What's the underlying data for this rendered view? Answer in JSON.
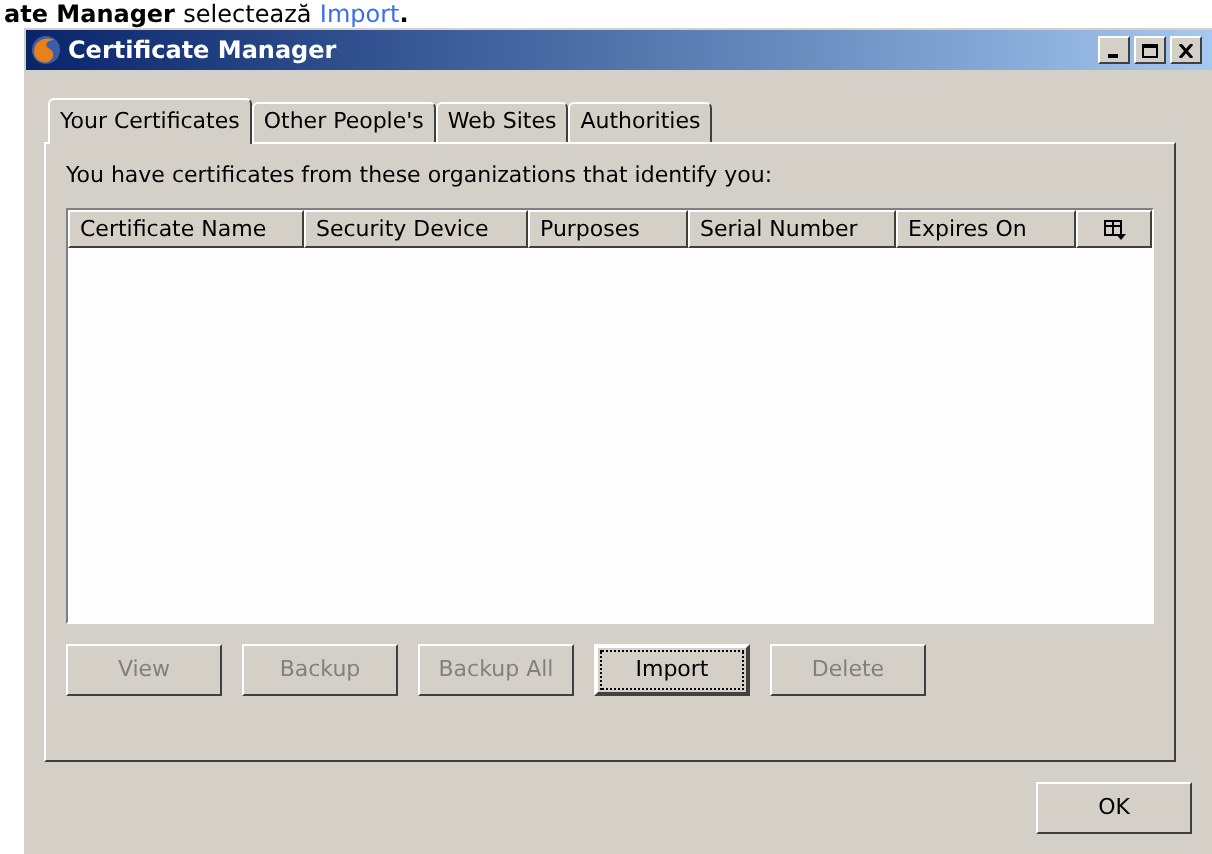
{
  "heading": {
    "text": "ate Manager",
    "rest": "selectează",
    "link": "Import",
    "end": "."
  },
  "window": {
    "title": "Certificate Manager"
  },
  "tabs": [
    {
      "label": "Your Certificates",
      "selected": true
    },
    {
      "label": "Other People's",
      "selected": false
    },
    {
      "label": "Web Sites",
      "selected": false
    },
    {
      "label": "Authorities",
      "selected": false
    }
  ],
  "description": "You have certificates from these organizations that identify you:",
  "table": {
    "columns": [
      "Certificate Name",
      "Security Device",
      "Purposes",
      "Serial Number",
      "Expires On"
    ]
  },
  "buttons": [
    {
      "label": "View",
      "disabled": true,
      "focused": false
    },
    {
      "label": "Backup",
      "disabled": true,
      "focused": false
    },
    {
      "label": "Backup All",
      "disabled": true,
      "focused": false
    },
    {
      "label": "Import",
      "disabled": false,
      "focused": true
    },
    {
      "label": "Delete",
      "disabled": true,
      "focused": false
    }
  ],
  "ok_button": "OK"
}
